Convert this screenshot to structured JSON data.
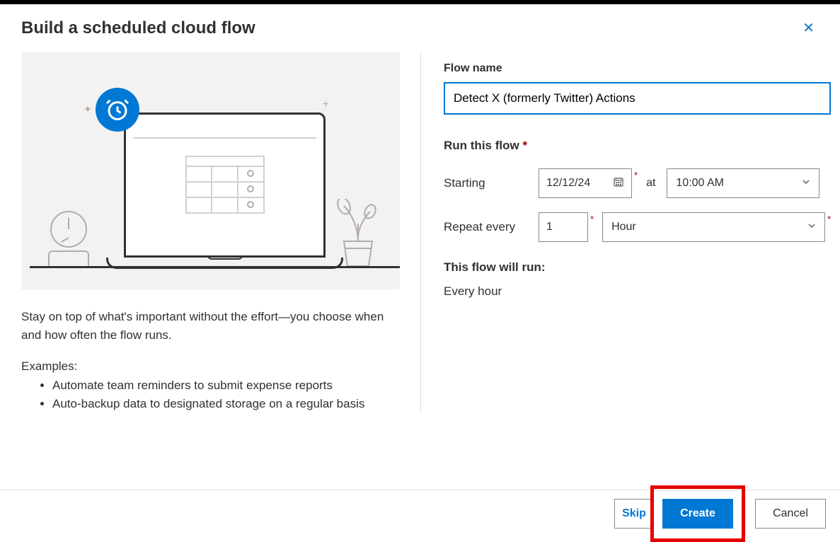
{
  "dialog": {
    "title": "Build a scheduled cloud flow",
    "description": "Stay on top of what's important without the effort—you choose when and how often the flow runs.",
    "examples_label": "Examples:",
    "examples": [
      "Automate team reminders to submit expense reports",
      "Auto-backup data to designated storage on a regular basis"
    ]
  },
  "form": {
    "flow_name_label": "Flow name",
    "flow_name_value": "Detect X (formerly Twitter) Actions",
    "run_label": "Run this flow",
    "starting_label": "Starting",
    "starting_date": "12/12/24",
    "at_label": "at",
    "starting_time": "10:00 AM",
    "repeat_label": "Repeat every",
    "repeat_count": "1",
    "repeat_unit": "Hour",
    "summary_label": "This flow will run:",
    "summary_text": "Every hour"
  },
  "footer": {
    "skip": "Skip",
    "create": "Create",
    "cancel": "Cancel"
  }
}
